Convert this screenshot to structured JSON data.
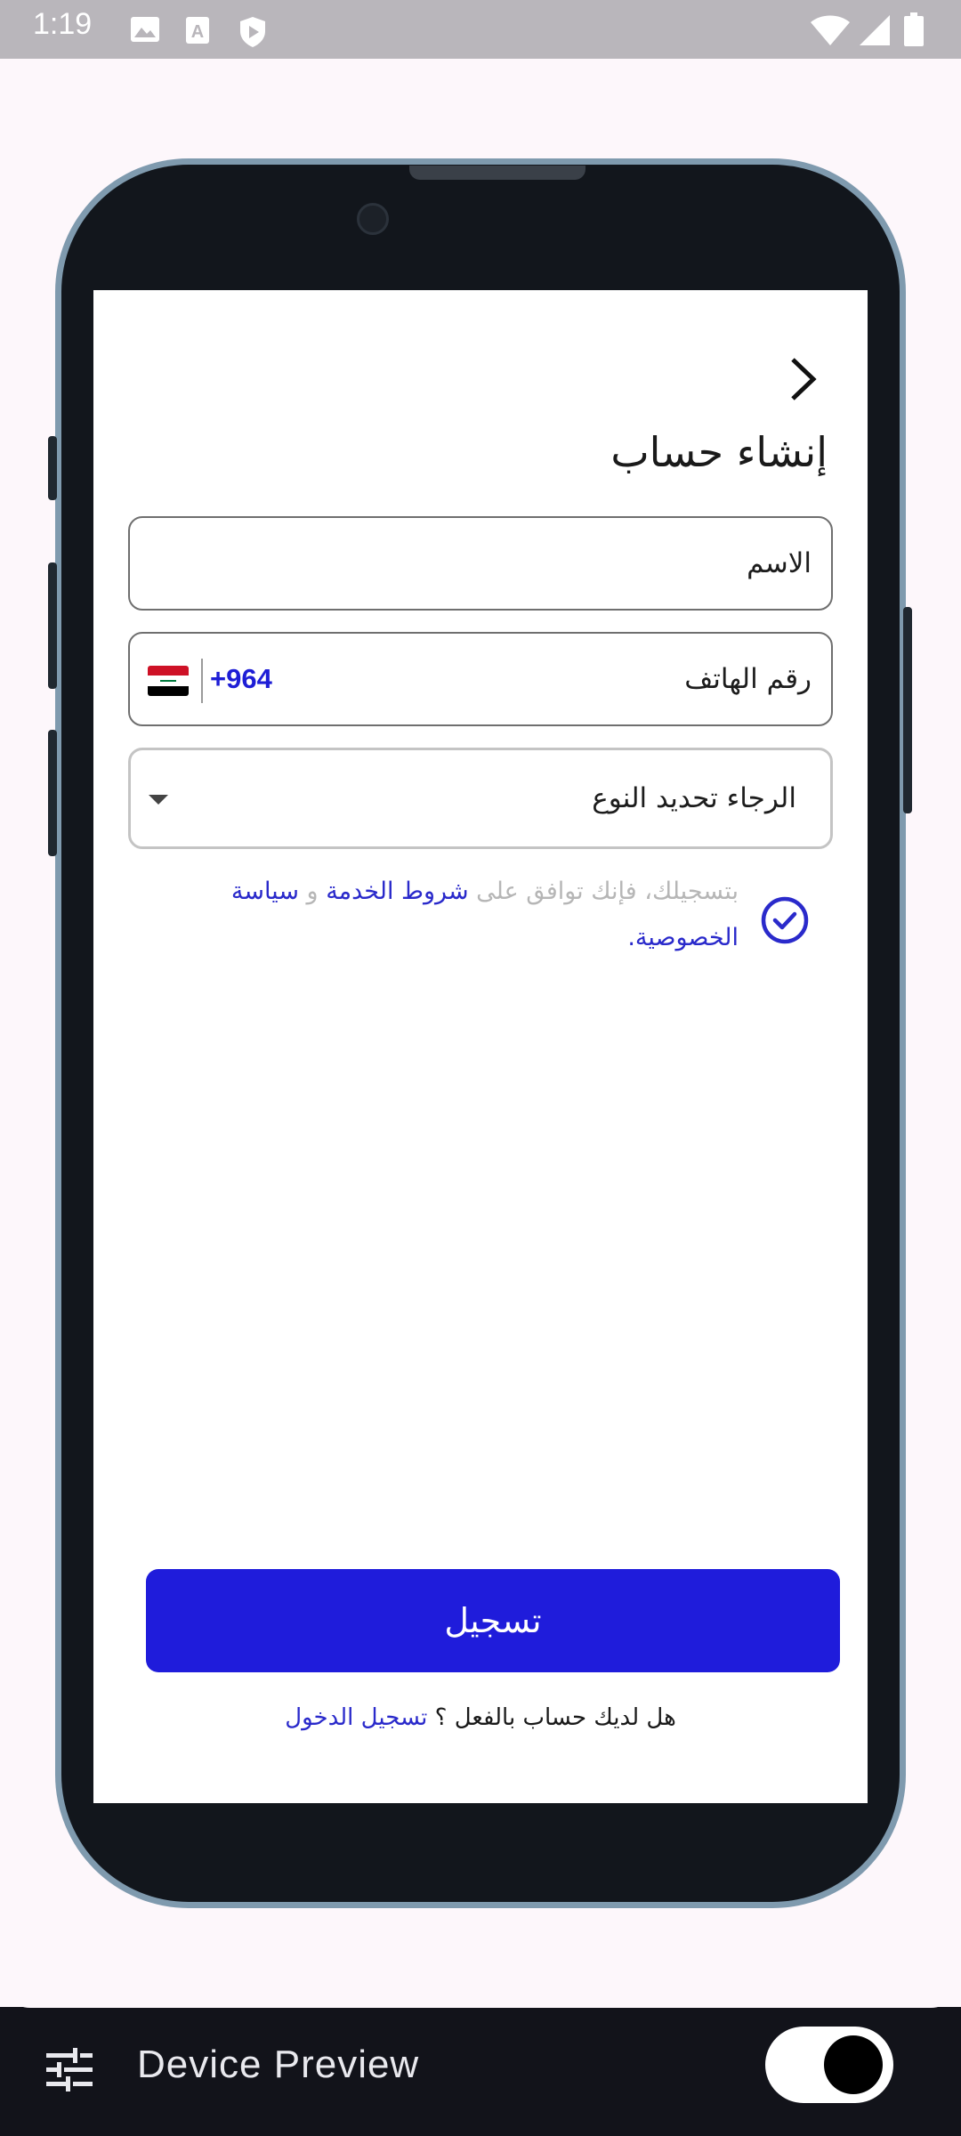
{
  "status_bar": {
    "time": "1:19"
  },
  "screen": {
    "title": "إنشاء حساب",
    "name_label": "الاسم",
    "phone_label": "رقم الهاتف",
    "country_code": "+964",
    "gender_placeholder": "الرجاء تحديد النوع",
    "terms": {
      "prefix": "بتسجيلك، فإنك توافق على",
      "terms_link": "شروط الخدمة",
      "and": "و",
      "privacy_link": "سياسة الخصوصية",
      "suffix": "."
    },
    "register_button": "تسجيل",
    "login_prompt": "هل لديك حساب بالفعل ؟",
    "login_link": "تسجيل الدخول"
  },
  "bottom_bar": {
    "label": "Device Preview",
    "toggle_on": true
  },
  "colors": {
    "accent": "#1f1cdb",
    "link": "#2a2acb",
    "frame": "#7f9aae"
  },
  "icons": [
    "image-icon",
    "text-a-icon",
    "shield-play-icon",
    "wifi-icon",
    "signal-icon",
    "battery-icon",
    "chevron-right-icon",
    "iraq-flag-icon",
    "dropdown-caret-icon",
    "check-circle-icon",
    "tune-icon"
  ]
}
